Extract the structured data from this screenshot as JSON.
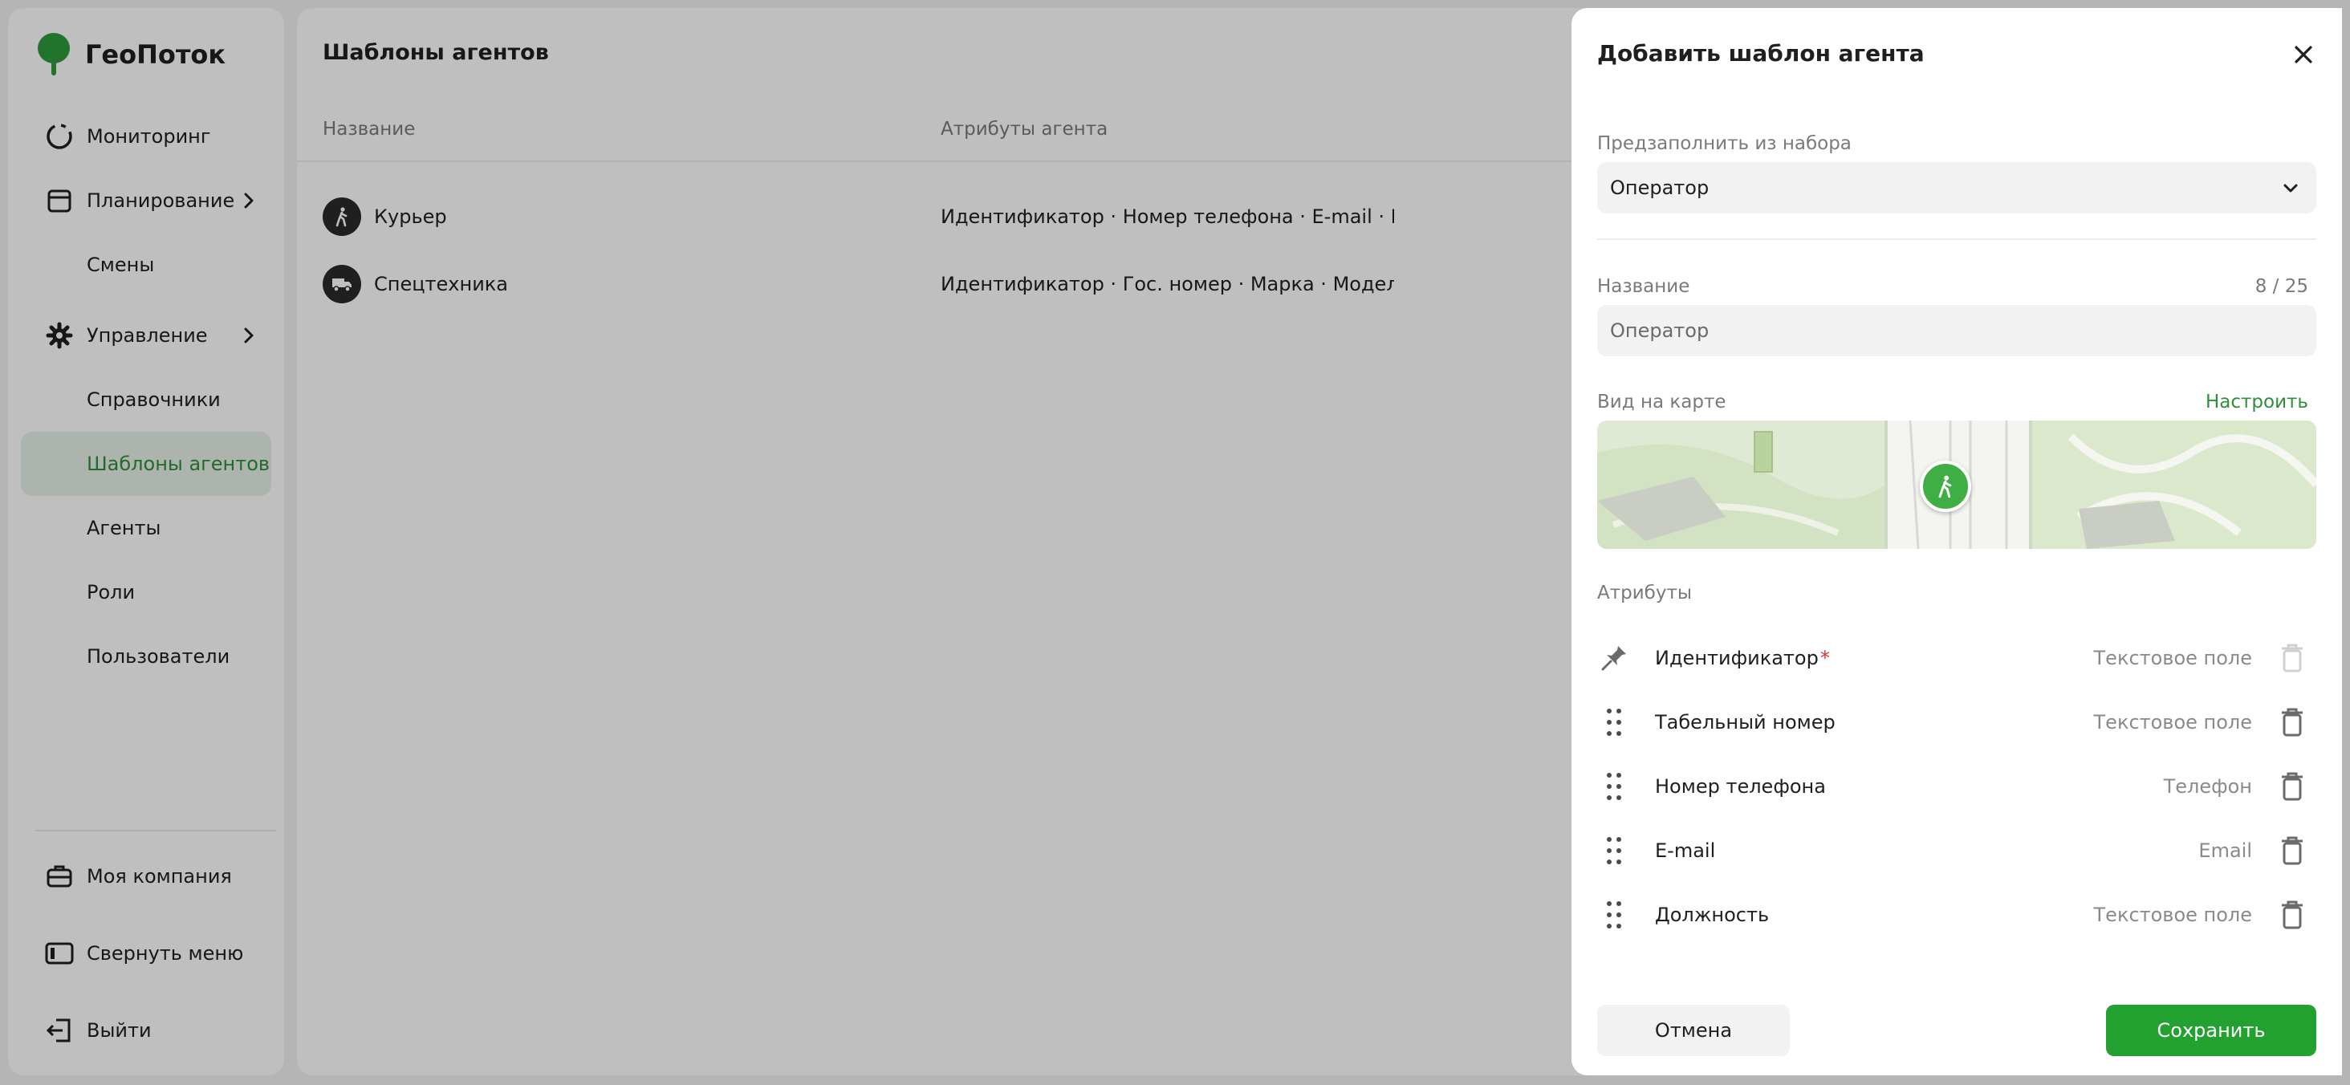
{
  "app": {
    "name": "ГеоПоток"
  },
  "sidebar": {
    "items": [
      {
        "label": "Мониторинг",
        "icon": "monitoring-icon"
      },
      {
        "label": "Планирование",
        "icon": "calendar-icon"
      },
      {
        "label": "Смены"
      },
      {
        "label": "Управление",
        "icon": "gear-icon"
      },
      {
        "label": "Справочники"
      },
      {
        "label": "Шаблоны агентов",
        "active": true
      },
      {
        "label": "Агенты"
      },
      {
        "label": "Роли"
      },
      {
        "label": "Пользователи"
      }
    ],
    "bottom": [
      {
        "label": "Моя компания",
        "icon": "briefcase-icon"
      },
      {
        "label": "Свернуть меню",
        "icon": "collapse-icon"
      },
      {
        "label": "Выйти",
        "icon": "logout-icon"
      }
    ]
  },
  "main": {
    "title": "Шаблоны агентов",
    "columns": [
      "Название",
      "Атрибуты агента"
    ],
    "rows": [
      {
        "name": "Курьер",
        "icon": "walking-person-icon",
        "attrs": "Идентификатор · Номер телефона · E-mail · Номер"
      },
      {
        "name": "Спецтехника",
        "icon": "truck-icon",
        "attrs": "Идентификатор · Гос. номер · Марка · Модель · Цвет"
      }
    ]
  },
  "panel": {
    "title": "Добавить шаблон агента",
    "prefill_label": "Предзаполнить из набора",
    "prefill_value": "Оператор",
    "name_label": "Название",
    "name_counter": "8 / 25",
    "name_value": "Оператор",
    "map_label": "Вид на карте",
    "map_link": "Настроить",
    "attributes_label": "Атрибуты",
    "attributes": [
      {
        "name": "Идентификатор",
        "required": "*",
        "type": "Текстовое поле",
        "handle": "pin-icon",
        "deletable": false
      },
      {
        "name": "Табельный номер",
        "type": "Текстовое поле",
        "handle": "drag-handle-icon",
        "deletable": true
      },
      {
        "name": "Номер телефона",
        "type": "Телефон",
        "handle": "drag-handle-icon",
        "deletable": true
      },
      {
        "name": "E-mail",
        "type": "Email",
        "handle": "drag-handle-icon",
        "deletable": true
      },
      {
        "name": "Должность",
        "type": "Текстовое поле",
        "handle": "drag-handle-icon",
        "deletable": true
      }
    ],
    "cancel_label": "Отмена",
    "save_label": "Сохранить"
  },
  "colors": {
    "accent": "#22a030",
    "accent_text": "#2f8f3a",
    "overlay": "rgba(0,0,0,0.25)"
  }
}
